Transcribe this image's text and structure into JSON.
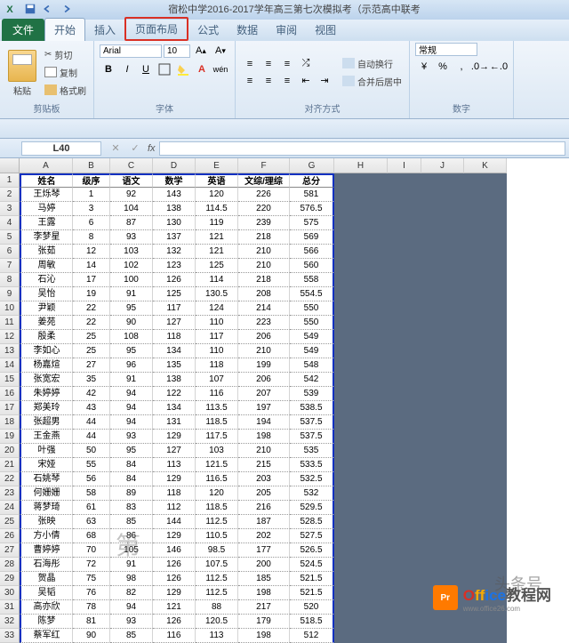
{
  "titlebar": {
    "text": "宿松中学2016-2017学年高三第七次模拟考（示范高中联考"
  },
  "tabs": {
    "file": "文件",
    "items": [
      "开始",
      "插入",
      "页面布局",
      "公式",
      "数据",
      "审阅",
      "视图"
    ]
  },
  "ribbon": {
    "paste": "粘贴",
    "cut": "剪切",
    "copy": "复制",
    "format_painter": "格式刷",
    "clipboard_label": "剪贴板",
    "font_name": "Arial",
    "font_size": "10",
    "font_label": "字体",
    "wrap": "自动换行",
    "merge": "合并后居中",
    "align_label": "对齐方式",
    "number_format": "常规",
    "number_label": "数字"
  },
  "namebox": "L40",
  "chart_data": {
    "type": "table",
    "columns": [
      "姓名",
      "级序",
      "语文",
      "数学",
      "英语",
      "文综/理综",
      "总分"
    ],
    "rows": [
      [
        "王烁琴",
        1,
        92,
        143,
        120,
        226,
        581
      ],
      [
        "马婷",
        3,
        104,
        138,
        114.5,
        220,
        576.5
      ],
      [
        "王露",
        6,
        87,
        130,
        119,
        239,
        575
      ],
      [
        "李梦星",
        8,
        93,
        137,
        121,
        218,
        569
      ],
      [
        "张茹",
        12,
        103,
        132,
        121,
        210,
        566
      ],
      [
        "周敏",
        14,
        102,
        123,
        125,
        210,
        560
      ],
      [
        "石沁",
        17,
        100,
        126,
        114,
        218,
        558
      ],
      [
        "吴怡",
        19,
        91,
        125,
        130.5,
        208,
        554.5
      ],
      [
        "尹颖",
        22,
        95,
        117,
        124,
        214,
        550
      ],
      [
        "姜苑",
        22,
        90,
        127,
        110,
        223,
        550
      ],
      [
        "殷柔",
        25,
        108,
        118,
        117,
        206,
        549
      ],
      [
        "李如心",
        25,
        95,
        134,
        110,
        210,
        549
      ],
      [
        "杨嘉煊",
        27,
        96,
        135,
        118,
        199,
        548
      ],
      [
        "张宽宏",
        35,
        91,
        138,
        107,
        206,
        542
      ],
      [
        "朱婷婷",
        42,
        94,
        122,
        116,
        207,
        539
      ],
      [
        "郑美玲",
        43,
        94,
        134,
        113.5,
        197,
        538.5
      ],
      [
        "张超男",
        44,
        94,
        131,
        118.5,
        194,
        537.5
      ],
      [
        "王金燕",
        44,
        93,
        129,
        117.5,
        198,
        537.5
      ],
      [
        "叶强",
        50,
        95,
        127,
        103,
        210,
        535
      ],
      [
        "宋娅",
        55,
        84,
        113,
        121.5,
        215,
        533.5
      ],
      [
        "石姚琴",
        56,
        84,
        129,
        116.5,
        203,
        532.5
      ],
      [
        "何姗姗",
        58,
        89,
        118,
        120,
        205,
        532
      ],
      [
        "蒋梦琦",
        61,
        83,
        112,
        118.5,
        216,
        529.5
      ],
      [
        "张映",
        63,
        85,
        144,
        112.5,
        187,
        528.5
      ],
      [
        "方小倩",
        68,
        "86",
        "129",
        "110.5",
        202,
        527.5
      ],
      [
        "曹婷婷",
        70,
        "105",
        "146",
        "98.5",
        177,
        526.5
      ],
      [
        "石海彤",
        72,
        91,
        126,
        107.5,
        200,
        524.5
      ],
      [
        "贺晶",
        75,
        98,
        126,
        112.5,
        185,
        521.5
      ],
      [
        "吴韬",
        76,
        82,
        129,
        112.5,
        198,
        521.5
      ],
      [
        "高亦欣",
        78,
        94,
        121,
        88,
        217,
        520
      ],
      [
        "陈梦",
        81,
        93,
        126,
        120.5,
        179,
        518.5
      ],
      [
        "蔡军红",
        90,
        85,
        116,
        113,
        198,
        512
      ]
    ]
  },
  "col_letters": [
    "A",
    "B",
    "C",
    "D",
    "E",
    "F",
    "G",
    "H",
    "I",
    "J",
    "K"
  ],
  "watermark_page": "第",
  "watermark_brand": "Office教程网",
  "watermark_url": "www.office26.com"
}
